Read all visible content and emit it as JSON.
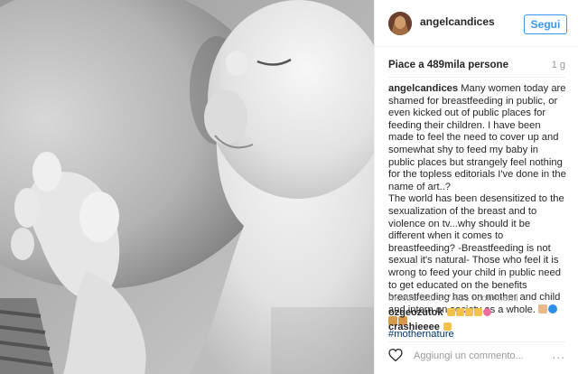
{
  "post": {
    "username": "angelcandices",
    "follow_label": "Segui",
    "likes": "Piace a 489mila persone",
    "age": "1 g",
    "caption": {
      "username": "angelcandices",
      "text": "Many women today are shamed for breastfeeding in public, or even kicked out of public places for feeding their children. I have been made to feel the need to cover up and somewhat shy to feed my baby in public places but strangely feel nothing for the topless editorials I've done in the name of art..?",
      "text2": "The world has been desensitized to the sexualization of the breast and to violence on tv...why should it be different when it comes to breastfeeding? -Breastfeeding is not sexual it's natural- Those who feel it is wrong to feed your child in public need to get educated on the benefits breastfeeding has on mother and child and intern on society as a whole.",
      "hashtag": "#mothernature"
    },
    "show_all": "mostra tutti e 7.431 i commenti",
    "comments": [
      {
        "username": "ozgeozutok"
      },
      {
        "username": "crashieeee"
      }
    ],
    "comment_placeholder": "Aggiungi un commento...",
    "more": "..."
  },
  "colors": {
    "accent": "#3897f0",
    "text": "#262626",
    "muted": "#999999",
    "hashtag": "#003569"
  },
  "icons": {
    "heart": "heart-outline-icon",
    "more": "more-options-icon"
  }
}
